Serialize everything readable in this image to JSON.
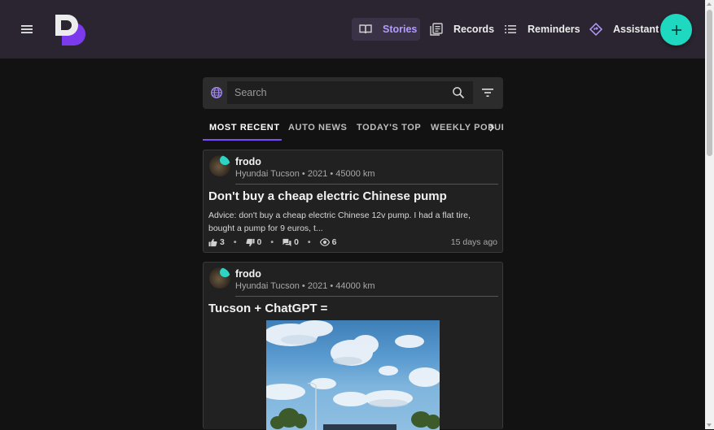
{
  "header": {
    "nav": [
      {
        "label": "Stories",
        "icon": "book-open-icon",
        "active": true
      },
      {
        "label": "Records",
        "icon": "records-icon",
        "active": false
      },
      {
        "label": "Reminders",
        "icon": "list-icon",
        "active": false
      },
      {
        "label": "Assistant",
        "icon": "diamond-icon",
        "active": false
      }
    ],
    "fab_symbol": "+"
  },
  "search": {
    "placeholder": "Search"
  },
  "tabs": [
    {
      "label": "MOST RECENT",
      "active": true
    },
    {
      "label": "AUTO NEWS",
      "active": false
    },
    {
      "label": "TODAY'S TOP",
      "active": false
    },
    {
      "label": "WEEKLY POPULAR",
      "active": false
    }
  ],
  "stories": [
    {
      "author": "frodo",
      "vehicle": "Hyundai Tucson • 2021 • 45000 km",
      "title": "Don't buy a cheap electric Chinese pump",
      "body": "Advice: don't buy a cheap electric Chinese 12v pump. I had a flat tire, bought a pump for 9 euros, t...",
      "likes": "3",
      "dislikes": "0",
      "comments": "0",
      "views": "6",
      "time_ago": "15 days ago"
    },
    {
      "author": "frodo",
      "vehicle": "Hyundai Tucson • 2021 • 44000 km",
      "title": "Tucson + ChatGPT ="
    }
  ],
  "colors": {
    "accent": "#7c4dff",
    "active_nav_text": "#b49cff",
    "fab": "#1ed8c0",
    "topbar": "#2a2530",
    "background": "#121212",
    "card": "#212121"
  }
}
